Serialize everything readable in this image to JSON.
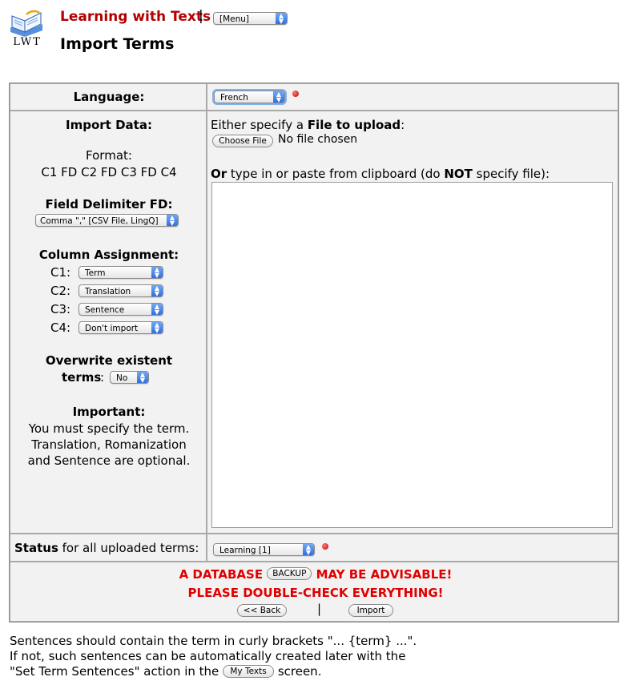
{
  "header": {
    "logo_text": "LWT",
    "app_title": "Learning with Texts",
    "separator": "|",
    "menu_select": "[Menu]",
    "page_title": "Import Terms"
  },
  "form": {
    "language_label": "Language:",
    "language_value": "French",
    "import_data_label": "Import Data:",
    "format_label": "Format:",
    "format_value": "C1 FD C2 FD C3 FD C4",
    "fd_label": "Field Delimiter FD:",
    "fd_value": "Comma \",\" [CSV File, LingQ]",
    "column_assignment_label": "Column Assignment:",
    "columns": [
      {
        "label": "C1:",
        "value": "Term"
      },
      {
        "label": "C2:",
        "value": "Translation"
      },
      {
        "label": "C3:",
        "value": "Sentence"
      },
      {
        "label": "C4:",
        "value": "Don't import"
      }
    ],
    "overwrite_label_line1": "Overwrite existent",
    "overwrite_label_line2": "terms",
    "overwrite_colon": ":",
    "overwrite_value": "No",
    "important_label": "Important:",
    "important_lines": [
      "You must specify the term.",
      "Translation, Romanization",
      "and Sentence are optional."
    ],
    "file_prefix": "Either specify a ",
    "file_bold": "File to upload",
    "file_suffix": ":",
    "choose_file_button": "Choose File",
    "no_file_text": "No file chosen",
    "paste_or": "Or",
    "paste_mid": " type in or paste from clipboard (do ",
    "paste_not": "NOT",
    "paste_end": " specify file):",
    "textarea_value": "",
    "status_bold": "Status",
    "status_rest": " for all uploaded terms:",
    "status_value": "Learning [1]"
  },
  "warning": {
    "line1_a": "A DATABASE",
    "backup_button": "BACKUP",
    "line1_b": "MAY BE ADVISABLE!",
    "line2": "PLEASE DOUBLE-CHECK EVERYTHING!",
    "back_button": "<< Back",
    "sep": "|",
    "import_button": "Import"
  },
  "footer": {
    "line1": "Sentences should contain the term in curly brackets \"... {term} ...\".",
    "line2": "If not, such sentences can be automatically created later with the",
    "line3_a": "\"Set Term Sentences\" action in the",
    "my_texts_button": "My Texts",
    "line3_b": "screen."
  },
  "icons": {
    "logo": "book-logo-icon",
    "required": "required-dot-icon",
    "select_arrow": "select-arrows-icon"
  },
  "colors": {
    "title_red": "#b30000",
    "warning_red": "#e00000",
    "cell_bg": "#f2f2f2",
    "select_accent": "#2f6fe0"
  }
}
